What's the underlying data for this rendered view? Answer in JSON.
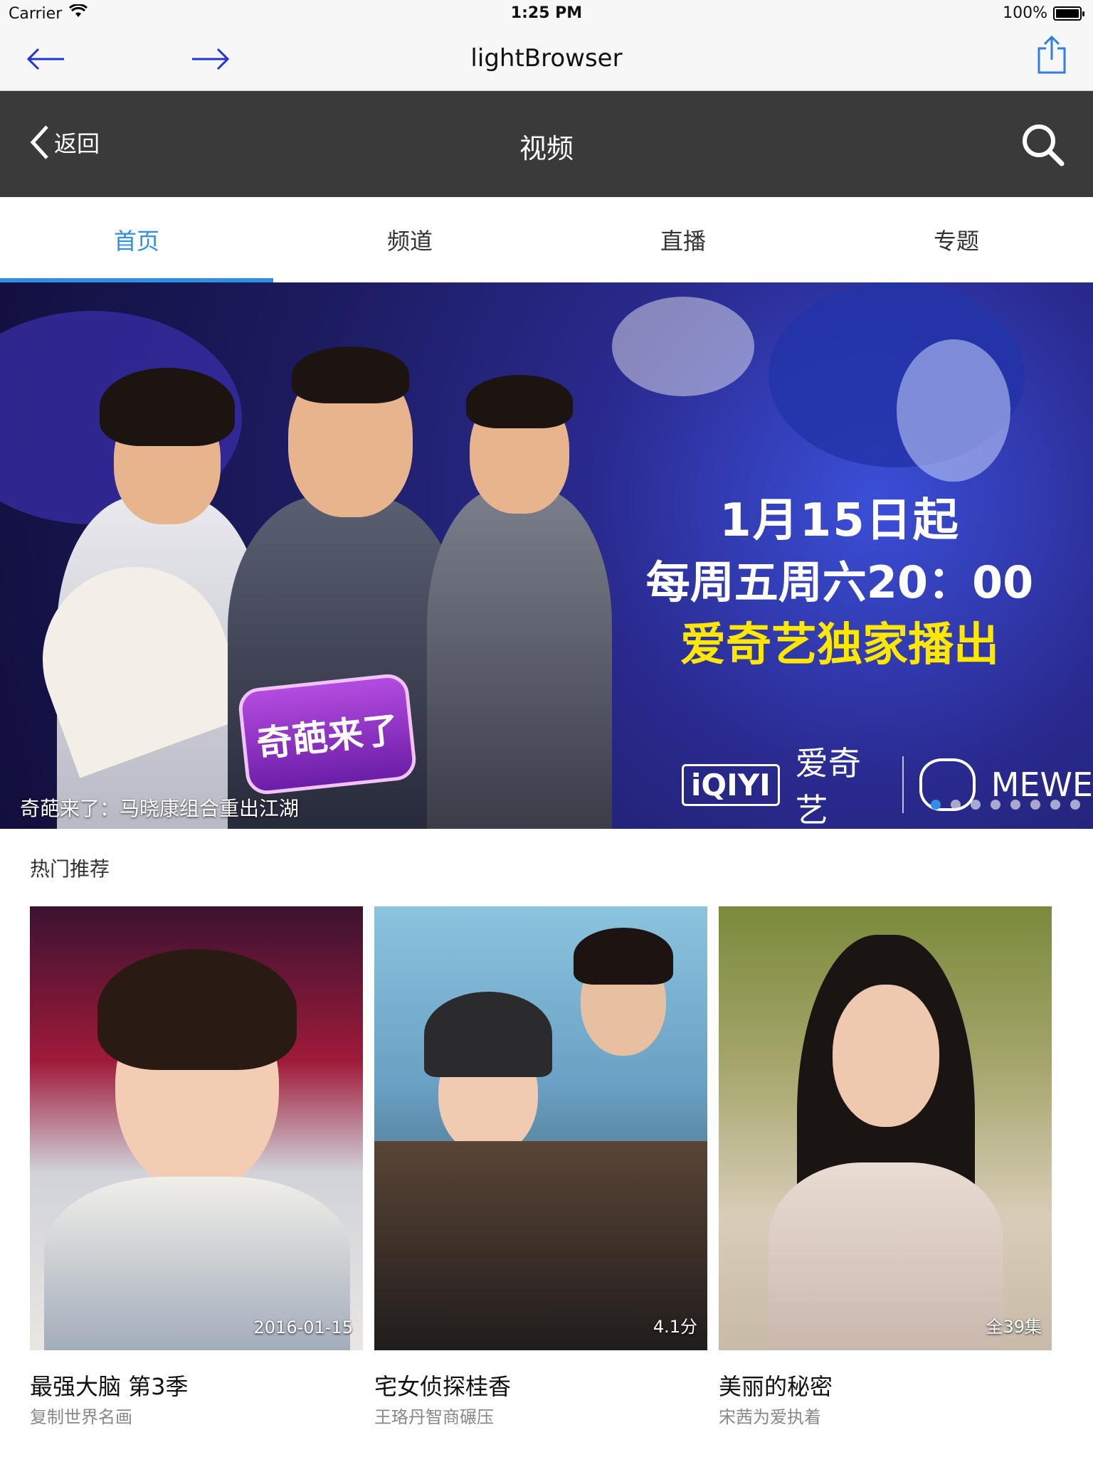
{
  "status_bar": {
    "carrier": "Carrier",
    "time": "1:25 PM",
    "battery": "100%",
    "battery_level": 1.0
  },
  "browser": {
    "title": "lightBrowser",
    "back_icon": "arrow-left-icon",
    "forward_icon": "arrow-right-icon",
    "share_icon": "share-icon",
    "accent": "#2034d6"
  },
  "header": {
    "back_label": "返回",
    "title": "视频"
  },
  "tabs": [
    {
      "label": "首页",
      "active": true
    },
    {
      "label": "频道",
      "active": false
    },
    {
      "label": "直播",
      "active": false
    },
    {
      "label": "专题",
      "active": false
    }
  ],
  "banner": {
    "promo_line1": "1月15日起",
    "promo_line2": "每周五周六20：00",
    "promo_line3": "爱奇艺独家播出",
    "iqiyi_logo": "iQIYI",
    "iqiyi_label": "爱奇艺",
    "mewe_label": "MEWE",
    "show_logo": "奇葩来了",
    "caption": "奇葩来了：马晓康组合重出江湖",
    "slide_count": 8,
    "active_slide": 1
  },
  "section": {
    "title": "热门推荐"
  },
  "cards": [
    {
      "title": "最强大脑 第3季",
      "subtitle": "复制世界名画",
      "badge": "2016-01-15"
    },
    {
      "title": "宅女侦探桂香",
      "subtitle": "王珞丹智商碾压",
      "badge": "4.1分"
    },
    {
      "title": "美丽的秘密",
      "subtitle": "宋茜为爱执着",
      "badge": "全39集"
    }
  ],
  "colors": {
    "tab_active": "#2f8ee6",
    "header_bg": "#3a3a3a",
    "promo_yellow": "#ffe700"
  }
}
